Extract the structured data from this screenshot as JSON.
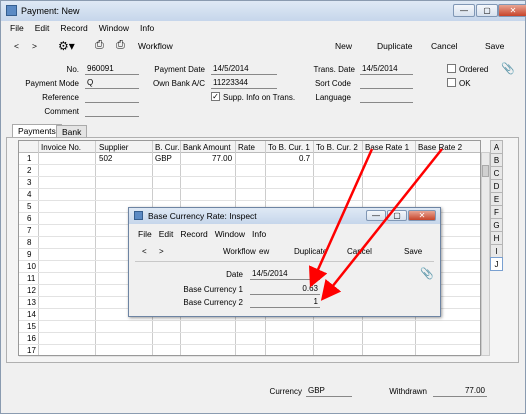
{
  "window": {
    "title": "Payment: New"
  },
  "menu": [
    "File",
    "Edit",
    "Record",
    "Window",
    "Info"
  ],
  "toolbar": {
    "back": "<",
    "forward": ">",
    "workflow": "Workflow",
    "new": "New",
    "duplicate": "Duplicate",
    "cancel": "Cancel",
    "save": "Save"
  },
  "header": {
    "no_label": "No.",
    "no": "960091",
    "paydate_label": "Payment Date",
    "paydate": "14/5/2014",
    "transdate_label": "Trans. Date",
    "transdate": "14/5/2014",
    "ordered_label": "Ordered",
    "mode_label": "Payment Mode",
    "mode": "Q",
    "ownbank_label": "Own Bank A/C",
    "ownbank": "11223344",
    "sortcode_label": "Sort Code",
    "ok_label": "OK",
    "reference_label": "Reference",
    "suppinfo_label": "Supp. Info on Trans.",
    "language_label": "Language",
    "comment_label": "Comment"
  },
  "tabs": [
    "Payments",
    "Bank"
  ],
  "grid": {
    "columns": [
      "Invoice No.",
      "Supplier",
      "B. Cur.",
      "Bank Amount",
      "Rate",
      "To B. Cur. 1",
      "To B. Cur. 2",
      "Base Rate 1",
      "Base Rate 2"
    ],
    "rownums": [
      "1",
      "2",
      "3",
      "4",
      "5",
      "6",
      "7",
      "8",
      "9",
      "10",
      "11",
      "12",
      "13",
      "14",
      "15",
      "16",
      "17"
    ],
    "row1": {
      "supplier": "502",
      "bcur": "GBP",
      "amount": "77.00",
      "tobcur1": "0.7"
    }
  },
  "side": [
    "A",
    "B",
    "C",
    "D",
    "E",
    "F",
    "G",
    "H",
    "I",
    "J"
  ],
  "dialog": {
    "title": "Base Currency Rate: Inspect",
    "menu": [
      "File",
      "Edit",
      "Record",
      "Window",
      "Info"
    ],
    "workflow": "Workflow",
    "ew": "ew",
    "duplicate": "Duplicate",
    "cancel": "Cancel",
    "save": "Save",
    "date_label": "Date",
    "date": "14/5/2014",
    "bc1_label": "Base Currency 1",
    "bc1": "0.63",
    "bc2_label": "Base Currency 2",
    "bc2": "1"
  },
  "footer": {
    "currency_label": "Currency",
    "currency": "GBP",
    "withdrawn_label": "Withdrawn",
    "withdrawn": "77.00"
  },
  "colors": {
    "arrow": "#ff0000",
    "title_gradient": "#c6d6eb"
  }
}
